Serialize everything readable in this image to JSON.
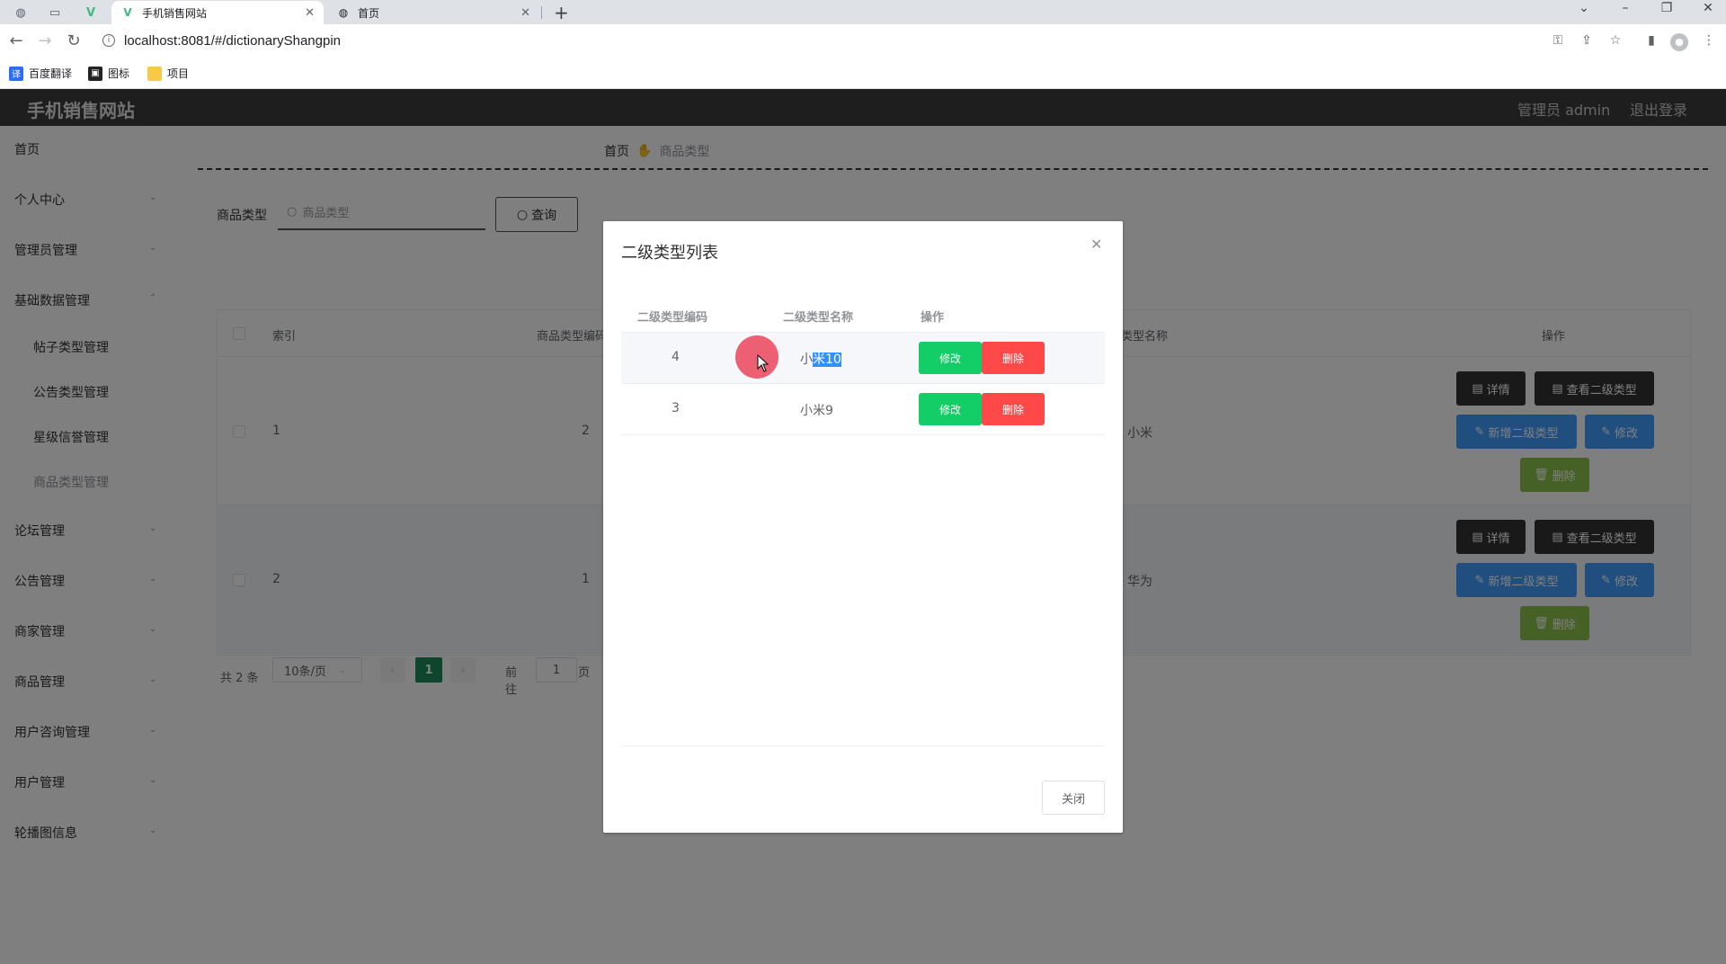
{
  "browser": {
    "tabs": [
      {
        "title": "手机销售网站",
        "active": true
      },
      {
        "title": "首页",
        "active": false
      }
    ],
    "url": "localhost:8081/#/dictionaryShangpin",
    "bookmarks": [
      {
        "label": "百度翻译",
        "icon": "translate-icon"
      },
      {
        "label": "图标",
        "icon": "image-icon"
      },
      {
        "label": "项目",
        "icon": "folder-icon"
      }
    ]
  },
  "app": {
    "brand": "手机销售网站",
    "admin_label": "管理员 admin",
    "logout_label": "退出登录"
  },
  "sidebar": {
    "items": [
      {
        "label": "首页"
      },
      {
        "label": "个人中心"
      },
      {
        "label": "管理员管理"
      },
      {
        "label": "基础数据管理"
      },
      {
        "label": "帖子类型管理"
      },
      {
        "label": "公告类型管理"
      },
      {
        "label": "星级信誉管理"
      },
      {
        "label": "商品类型管理"
      },
      {
        "label": "论坛管理"
      },
      {
        "label": "公告管理"
      },
      {
        "label": "商家管理"
      },
      {
        "label": "商品管理"
      },
      {
        "label": "用户咨询管理"
      },
      {
        "label": "用户管理"
      },
      {
        "label": "轮播图信息"
      }
    ]
  },
  "breadcrumb": {
    "home": "首页",
    "current": "商品类型"
  },
  "search": {
    "label": "商品类型",
    "placeholder": "商品类型",
    "button": "查询"
  },
  "table": {
    "headers": {
      "index": "索引",
      "code": "商品类型编码",
      "name": "类型名称",
      "actions": "操作"
    },
    "rows": [
      {
        "index": "1",
        "code": "2",
        "name": "小米"
      },
      {
        "index": "2",
        "code": "1",
        "name": "华为"
      }
    ],
    "buttons": {
      "detail": "详情",
      "view_sub": "查看二级类型",
      "add_sub": "新增二级类型",
      "edit": "修改",
      "delete": "删除"
    }
  },
  "pagination": {
    "total": "共 2 条",
    "page_size": "10条/页",
    "current": "1",
    "goto_prefix": "前往",
    "goto_value": "1",
    "goto_suffix": "页"
  },
  "dialog": {
    "title": "二级类型列表",
    "headers": {
      "code": "二级类型编码",
      "name": "二级类型名称",
      "actions": "操作"
    },
    "rows": [
      {
        "code": "4",
        "name_prefix": "小",
        "name_selected": "米10"
      },
      {
        "code": "3",
        "name": "小米9"
      }
    ],
    "edit": "修改",
    "delete": "删除",
    "close": "关闭"
  }
}
